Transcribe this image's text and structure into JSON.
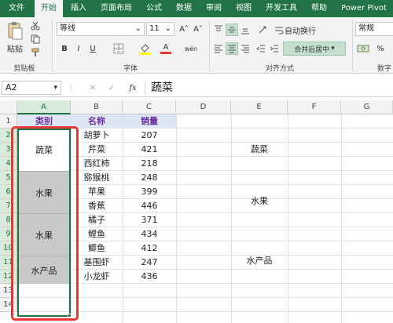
{
  "menu": {
    "tabs": [
      "文件",
      "开始",
      "插入",
      "页面布局",
      "公式",
      "数据",
      "审阅",
      "视图",
      "开发工具",
      "帮助",
      "Power Pivot"
    ]
  },
  "ribbon": {
    "clipboard": {
      "paste_label": "粘贴",
      "group_label": "剪贴板"
    },
    "font": {
      "font_name": "等线",
      "font_size": "11",
      "grow": "A˄",
      "shrink": "A˅",
      "bold": "B",
      "italic": "I",
      "underline": "U",
      "color_a": "A",
      "wen": "wén",
      "group_label": "字体"
    },
    "alignment": {
      "wrap_label": "自动换行",
      "merge_label": "合并后居中",
      "group_label": "对齐方式"
    },
    "number": {
      "format": "常规",
      "percent": "%",
      "group_label": "数字"
    }
  },
  "formula_bar": {
    "name_box": "A2",
    "fx": "fx",
    "content": "蔬菜"
  },
  "columns": [
    "A",
    "B",
    "C",
    "D",
    "E",
    "F",
    "G"
  ],
  "rows": [
    "1",
    "2",
    "3",
    "4",
    "5",
    "6",
    "7",
    "8",
    "9",
    "10",
    "11",
    "12",
    "13",
    "14"
  ],
  "table": {
    "headers": [
      "类别",
      "名称",
      "销量"
    ],
    "names": [
      "胡萝卜",
      "芹菜",
      "西红柿",
      "猕猴桃",
      "苹果",
      "香蕉",
      "橘子",
      "鲤鱼",
      "鲫鱼",
      "基围虾",
      "小龙虾"
    ],
    "sales": [
      "207",
      "421",
      "218",
      "248",
      "399",
      "446",
      "371",
      "434",
      "412",
      "247",
      "436"
    ],
    "col_a": [
      "蔬菜",
      "水果",
      "水果",
      "水产品"
    ],
    "col_e": [
      "蔬菜",
      "水果",
      "水产品"
    ]
  },
  "colors": {
    "excel_green": "#217346",
    "header_fill": "#dde6f4",
    "header_text": "#7030a0",
    "highlight_red": "#e53935",
    "gray_fill": "#c9c9c9"
  }
}
